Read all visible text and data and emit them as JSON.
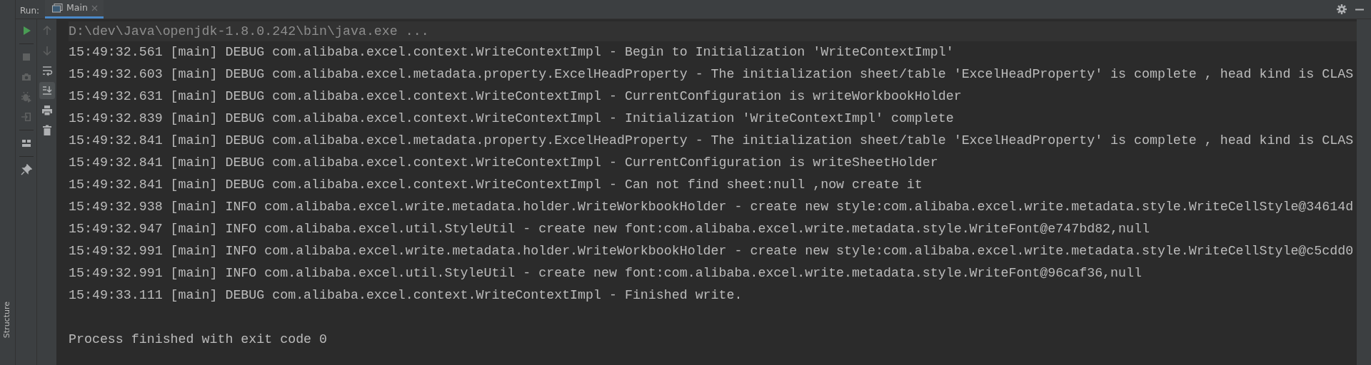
{
  "tool_window": {
    "title": "Run:",
    "tabs": [
      {
        "label": "Main",
        "selected": true
      }
    ]
  },
  "left_stripe": [
    {
      "label": "Structure"
    }
  ],
  "actions": [
    {
      "kind": "run",
      "disabled": false
    },
    {
      "kind": "stop",
      "disabled": true
    },
    {
      "kind": "camera",
      "disabled": true
    },
    {
      "kind": "bug",
      "disabled": true
    },
    {
      "kind": "exit",
      "disabled": true
    },
    {
      "kind": "layout",
      "disabled": false
    },
    {
      "kind": "pin",
      "disabled": false
    }
  ],
  "console_actions": [
    {
      "kind": "up",
      "disabled": true,
      "selected": false
    },
    {
      "kind": "down",
      "disabled": true,
      "selected": false
    },
    {
      "kind": "wrap",
      "disabled": false,
      "selected": false
    },
    {
      "kind": "scroll-end",
      "disabled": false,
      "selected": true
    },
    {
      "kind": "print",
      "disabled": false,
      "selected": false
    },
    {
      "kind": "trash",
      "disabled": false,
      "selected": false
    }
  ],
  "console": {
    "command": "D:\\dev\\Java\\openjdk-1.8.0.242\\bin\\java.exe ...",
    "lines": [
      "15:49:32.561 [main] DEBUG com.alibaba.excel.context.WriteContextImpl - Begin to Initialization 'WriteContextImpl'",
      "15:49:32.603 [main] DEBUG com.alibaba.excel.metadata.property.ExcelHeadProperty - The initialization sheet/table 'ExcelHeadProperty' is complete , head kind is CLAS",
      "15:49:32.631 [main] DEBUG com.alibaba.excel.context.WriteContextImpl - CurrentConfiguration is writeWorkbookHolder",
      "15:49:32.839 [main] DEBUG com.alibaba.excel.context.WriteContextImpl - Initialization 'WriteContextImpl' complete",
      "15:49:32.841 [main] DEBUG com.alibaba.excel.metadata.property.ExcelHeadProperty - The initialization sheet/table 'ExcelHeadProperty' is complete , head kind is CLAS",
      "15:49:32.841 [main] DEBUG com.alibaba.excel.context.WriteContextImpl - CurrentConfiguration is writeSheetHolder",
      "15:49:32.841 [main] DEBUG com.alibaba.excel.context.WriteContextImpl - Can not find sheet:null ,now create it",
      "15:49:32.938 [main] INFO com.alibaba.excel.write.metadata.holder.WriteWorkbookHolder - create new style:com.alibaba.excel.write.metadata.style.WriteCellStyle@34614d",
      "15:49:32.947 [main] INFO com.alibaba.excel.util.StyleUtil - create new font:com.alibaba.excel.write.metadata.style.WriteFont@e747bd82,null",
      "15:49:32.991 [main] INFO com.alibaba.excel.write.metadata.holder.WriteWorkbookHolder - create new style:com.alibaba.excel.write.metadata.style.WriteCellStyle@c5cdd0",
      "15:49:32.991 [main] INFO com.alibaba.excel.util.StyleUtil - create new font:com.alibaba.excel.write.metadata.style.WriteFont@96caf36,null",
      "15:49:33.111 [main] DEBUG com.alibaba.excel.context.WriteContextImpl - Finished write."
    ],
    "exit_message": "Process finished with exit code 0"
  }
}
